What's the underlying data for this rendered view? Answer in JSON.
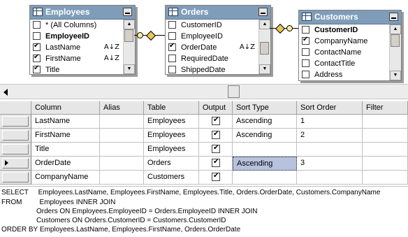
{
  "tables": [
    {
      "name": "Employees",
      "columns": [
        {
          "label": "* (All Columns)",
          "checked": false,
          "pk": false,
          "sort": ""
        },
        {
          "label": "EmployeeID",
          "checked": false,
          "pk": true,
          "sort": ""
        },
        {
          "label": "LastName",
          "checked": true,
          "pk": false,
          "sort": "A↓Z"
        },
        {
          "label": "FirstName",
          "checked": true,
          "pk": false,
          "sort": "A↓Z"
        },
        {
          "label": "Title",
          "checked": true,
          "pk": false,
          "sort": ""
        }
      ]
    },
    {
      "name": "Orders",
      "columns": [
        {
          "label": "CustomerID",
          "checked": false,
          "pk": false,
          "sort": ""
        },
        {
          "label": "EmployeeID",
          "checked": false,
          "pk": false,
          "sort": ""
        },
        {
          "label": "OrderDate",
          "checked": true,
          "pk": false,
          "sort": "A↓Z"
        },
        {
          "label": "RequiredDate",
          "checked": false,
          "pk": false,
          "sort": ""
        },
        {
          "label": "ShippedDate",
          "checked": false,
          "pk": false,
          "sort": ""
        }
      ]
    },
    {
      "name": "Customers",
      "columns": [
        {
          "label": "CustomerID",
          "checked": false,
          "pk": true,
          "sort": ""
        },
        {
          "label": "CompanyName",
          "checked": true,
          "pk": false,
          "sort": ""
        },
        {
          "label": "ContactName",
          "checked": false,
          "pk": false,
          "sort": ""
        },
        {
          "label": "ContactTitle",
          "checked": false,
          "pk": false,
          "sort": ""
        },
        {
          "label": "Address",
          "checked": false,
          "pk": false,
          "sort": ""
        }
      ]
    }
  ],
  "grid": {
    "headers": [
      "Column",
      "Alias",
      "Table",
      "Output",
      "Sort Type",
      "Sort Order",
      "Filter"
    ],
    "rows": [
      {
        "column": "LastName",
        "alias": "",
        "table": "Employees",
        "output": true,
        "sort_type": "Ascending",
        "sort_order": "1",
        "filter": "",
        "current": false,
        "highlight_sort": false
      },
      {
        "column": "FirstName",
        "alias": "",
        "table": "Employees",
        "output": true,
        "sort_type": "Ascending",
        "sort_order": "2",
        "filter": "",
        "current": false,
        "highlight_sort": false
      },
      {
        "column": "Title",
        "alias": "",
        "table": "Employees",
        "output": true,
        "sort_type": "",
        "sort_order": "",
        "filter": "",
        "current": false,
        "highlight_sort": false
      },
      {
        "column": "OrderDate",
        "alias": "",
        "table": "Orders",
        "output": true,
        "sort_type": "Ascending",
        "sort_order": "3",
        "filter": "",
        "current": true,
        "highlight_sort": true
      },
      {
        "column": "CompanyName",
        "alias": "",
        "table": "Customers",
        "output": true,
        "sort_type": "",
        "sort_order": "",
        "filter": "",
        "current": false,
        "highlight_sort": false
      }
    ]
  },
  "sql": {
    "lines": [
      "SELECT     Employees.LastName, Employees.FirstName, Employees.Title, Orders.OrderDate, Customers.CompanyName",
      "FROM         Employees INNER JOIN",
      "                  Orders ON Employees.EmployeeID = Orders.EmployeeID INNER JOIN",
      "                  Customers ON Orders.CustomerID = Customers.CustomerID",
      "ORDER BY Employees.LastName, Employees.FirstName, Orders.OrderDate"
    ]
  }
}
